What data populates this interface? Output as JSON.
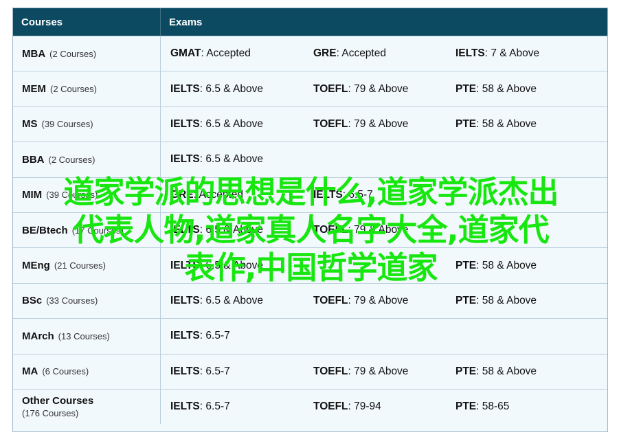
{
  "header": {
    "courses": "Courses",
    "exams": "Exams"
  },
  "rows": [
    {
      "degree": "MBA",
      "count": "(2 Courses)",
      "exams": [
        {
          "name": "GMAT",
          "value": ": Accepted"
        },
        {
          "name": "GRE",
          "value": ": Accepted"
        },
        {
          "name": "IELTS",
          "value": ": 7 & Above"
        }
      ]
    },
    {
      "degree": "MEM",
      "count": "(2 Courses)",
      "exams": [
        {
          "name": "IELTS",
          "value": ": 6.5 & Above"
        },
        {
          "name": "TOEFL",
          "value": ": 79 & Above"
        },
        {
          "name": "PTE",
          "value": ": 58 & Above"
        }
      ]
    },
    {
      "degree": "MS",
      "count": "(39 Courses)",
      "exams": [
        {
          "name": "IELTS",
          "value": ": 6.5 & Above"
        },
        {
          "name": "TOEFL",
          "value": ": 79 & Above"
        },
        {
          "name": "PTE",
          "value": ": 58 & Above"
        }
      ]
    },
    {
      "degree": "BBA",
      "count": "(2 Courses)",
      "exams": [
        {
          "name": "IELTS",
          "value": ": 6.5 & Above"
        }
      ]
    },
    {
      "degree": "MIM",
      "count": "(39 Courses)",
      "exams": [
        {
          "name": "GRE",
          "value": ": Accepted"
        },
        {
          "name": "IELTS",
          "value": ": 6.5-7"
        }
      ]
    },
    {
      "degree": "BE/Btech",
      "count": "(17 Courses)",
      "exams": [
        {
          "name": "IELTS",
          "value": ": 6.5 & Above"
        },
        {
          "name": "TOEFL",
          "value": ": 79 & Above"
        }
      ]
    },
    {
      "degree": "MEng",
      "count": "(21 Courses)",
      "exams": [
        {
          "name": "IELTS",
          "value": ": 6.5 & Above"
        },
        {
          "name": "",
          "value": ""
        },
        {
          "name": "PTE",
          "value": ": 58 & Above"
        }
      ]
    },
    {
      "degree": "BSc",
      "count": "(33 Courses)",
      "exams": [
        {
          "name": "IELTS",
          "value": ": 6.5 & Above"
        },
        {
          "name": "TOEFL",
          "value": ": 79 & Above"
        },
        {
          "name": "PTE",
          "value": ": 58 & Above"
        }
      ]
    },
    {
      "degree": "MArch",
      "count": "(13 Courses)",
      "exams": [
        {
          "name": "IELTS",
          "value": ": 6.5-7"
        }
      ]
    },
    {
      "degree": "MA",
      "count": "(6 Courses)",
      "exams": [
        {
          "name": "IELTS",
          "value": ": 6.5-7"
        },
        {
          "name": "TOEFL",
          "value": ": 79 & Above"
        },
        {
          "name": "PTE",
          "value": ": 58 & Above"
        }
      ]
    },
    {
      "degree": "Other Courses",
      "count": "(176 Courses)",
      "two_line": true,
      "exams": [
        {
          "name": "IELTS",
          "value": ": 6.5-7"
        },
        {
          "name": "TOEFL",
          "value": ": 79-94"
        },
        {
          "name": "PTE",
          "value": ": 58-65"
        }
      ]
    }
  ],
  "overlay": {
    "line1": "道家学派的思想是什么,道家学派杰出",
    "line2": "代表人物,道家真人名字大全,道家代",
    "line3": "表作,中国哲学道家"
  },
  "colors": {
    "header_bg": "#0c4a62",
    "overlay_text": "#17e60f",
    "row_bg": "#f2f9fd"
  }
}
